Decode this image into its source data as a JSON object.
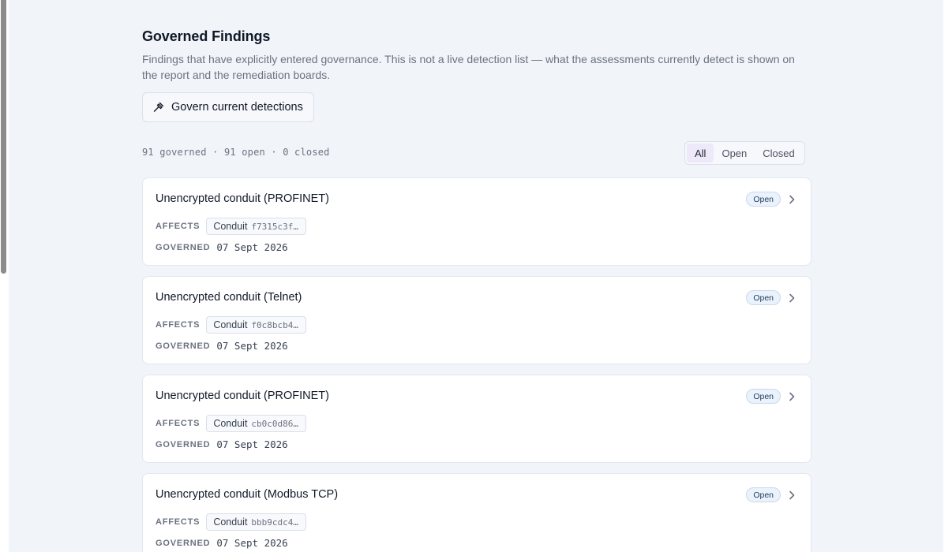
{
  "page": {
    "title": "Governed Findings",
    "description": "Findings that have explicitly entered governance. This is not a live detection list — what the assessments currently detect is shown on the report and the remediation boards.",
    "govern_button": {
      "label": "Govern current detections",
      "icon": "hammer-icon"
    },
    "summary": "91 governed · 91 open · 0 closed"
  },
  "filter": {
    "tabs": [
      {
        "label": "All",
        "active": true
      },
      {
        "label": "Open",
        "active": false
      },
      {
        "label": "Closed",
        "active": false
      }
    ]
  },
  "labels": {
    "affects": "AFFECTS",
    "governed": "GOVERNED"
  },
  "findings": [
    {
      "title": "Unencrypted conduit (PROFINET)",
      "status": "Open",
      "chip_label": "Conduit",
      "chip_id": "f7315c3f…",
      "governed_date": "07 Sept 2026"
    },
    {
      "title": "Unencrypted conduit (Telnet)",
      "status": "Open",
      "chip_label": "Conduit",
      "chip_id": "f0c8bcb4…",
      "governed_date": "07 Sept 2026"
    },
    {
      "title": "Unencrypted conduit (PROFINET)",
      "status": "Open",
      "chip_label": "Conduit",
      "chip_id": "cb0c0d86…",
      "governed_date": "07 Sept 2026"
    },
    {
      "title": "Unencrypted conduit (Modbus TCP)",
      "status": "Open",
      "chip_label": "Conduit",
      "chip_id": "bbb9cdc4…",
      "governed_date": "07 Sept 2026"
    }
  ]
}
